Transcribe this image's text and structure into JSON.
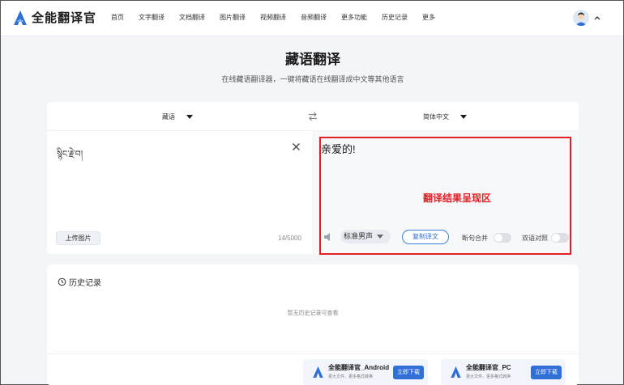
{
  "brand": {
    "name": "全能翻译官",
    "accent": "#2f6fd6"
  },
  "nav": [
    "首页",
    "文字翻译",
    "文档翻译",
    "图片翻译",
    "视频翻译",
    "音频翻译",
    "更多功能",
    "历史记录",
    "更多"
  ],
  "page": {
    "title": "藏语翻译",
    "subtitle": "在线藏语翻译器，一键将藏语在线翻译成中文等其他语言"
  },
  "translator": {
    "source_lang": "藏语",
    "target_lang": "简体中文",
    "source_text": "སྙིང་རྗེ་བ།",
    "char_count": "14/5000",
    "upload_label": "上传图片",
    "target_text": "亲爱的!",
    "voice": "标准男声",
    "copy_label": "复制译文",
    "merge_label": "断句合并",
    "merge_on": false,
    "bilingual_label": "双语对照",
    "bilingual_on": false
  },
  "annotation": {
    "label": "翻译结果呈现区",
    "color": "#e21f26"
  },
  "history": {
    "title": "历史记录",
    "empty_text": "暂无历史记录可查看"
  },
  "downloads": [
    {
      "name": "全能翻译官_Android",
      "desc": "更大文件、更多格式转换",
      "button": "立即下载"
    },
    {
      "name": "全能翻译官_PC",
      "desc": "更大文件、更多格式转换",
      "button": "立即下载"
    }
  ]
}
